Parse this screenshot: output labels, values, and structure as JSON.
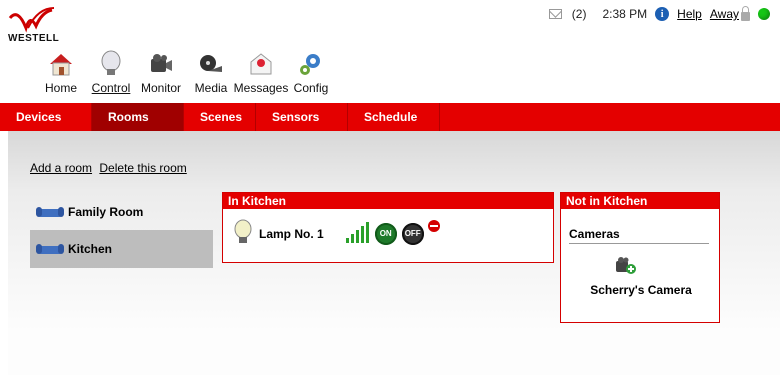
{
  "brand": {
    "logo_text": "WESTELL"
  },
  "status": {
    "messages_count": "(2)",
    "time": "2:38 PM",
    "help_label": "Help",
    "mode_label": "Away",
    "status_color": "#15c515"
  },
  "toolbar": {
    "items": [
      {
        "label": "Home",
        "icon": "home-icon"
      },
      {
        "label": "Control",
        "icon": "lightbulb-icon"
      },
      {
        "label": "Monitor",
        "icon": "camera-icon"
      },
      {
        "label": "Media",
        "icon": "film-reel-icon"
      },
      {
        "label": "Messages",
        "icon": "envelope-icon"
      },
      {
        "label": "Config",
        "icon": "gears-icon"
      }
    ],
    "active": "Control"
  },
  "nav": {
    "tabs": [
      {
        "label": "Devices"
      },
      {
        "label": "Rooms"
      },
      {
        "label": "Scenes"
      },
      {
        "label": "Sensors"
      },
      {
        "label": "Schedule"
      }
    ],
    "active": "Rooms"
  },
  "room_actions": {
    "add": "Add a room",
    "delete": "Delete this room"
  },
  "rooms": [
    {
      "name": "Family Room"
    },
    {
      "name": "Kitchen"
    }
  ],
  "selected_room": "Kitchen",
  "in_room_panel": {
    "title": "In Kitchen",
    "devices": [
      {
        "name": "Lamp No. 1",
        "on_label": "ON",
        "off_label": "OFF",
        "signal_bars": 5
      }
    ]
  },
  "not_in_room_panel": {
    "title": "Not in Kitchen",
    "category": "Cameras",
    "items": [
      {
        "name": "Scherry's Camera"
      }
    ]
  },
  "colors": {
    "accent_red": "#e40000",
    "active_tab": "#a00000",
    "signal_green": "#2aa02a"
  }
}
